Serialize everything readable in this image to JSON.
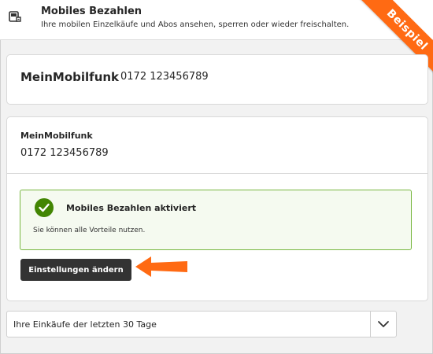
{
  "header": {
    "icon": "payment-device-icon",
    "title": "Mobiles Bezahlen",
    "subtitle": "Ihre mobilen Einzelkäufe und Abos ansehen, sperren oder wieder freischalten.",
    "badge": "Beispiel"
  },
  "account_card": {
    "name": "MeinMobilfunk",
    "number": "0172 123456789"
  },
  "detail_card": {
    "name": "MeinMobilfunk",
    "number": "0172 123456789",
    "status": {
      "icon": "checkmark-icon",
      "title": "Mobiles Bezahlen aktiviert",
      "description": "Sie können alle Vorteile nutzen."
    },
    "settings_button": "Einstellungen ändern"
  },
  "purchases_select": {
    "label": "Ihre Einkäufe der letzten 30 Tage",
    "icon": "chevron-down-icon"
  },
  "colors": {
    "badge": "#ff6a13",
    "success_border": "#79b742",
    "success_icon": "#428503",
    "button": "#333333"
  }
}
